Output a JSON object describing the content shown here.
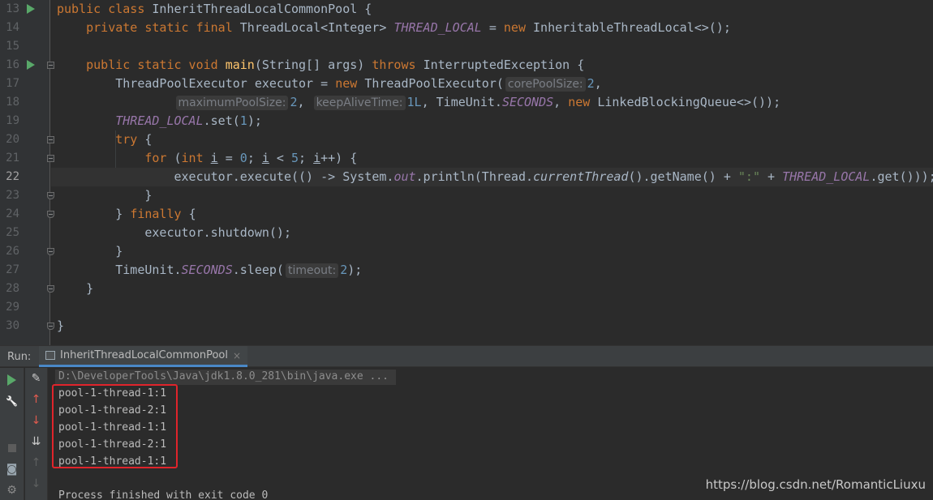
{
  "editor": {
    "line_numbers": [
      "13",
      "14",
      "15",
      "16",
      "17",
      "18",
      "19",
      "20",
      "21",
      "22",
      "23",
      "24",
      "25",
      "26",
      "27",
      "28",
      "29",
      "30"
    ],
    "current_line": "22",
    "code": {
      "l13_kw": "public class ",
      "l13_name": "InheritThreadLocalCommonPool {",
      "l14_kw": "private static final ",
      "l14_type": "ThreadLocal<Integer> ",
      "l14_field": "THREAD_LOCAL",
      "l14_eq": " = ",
      "l14_new": "new ",
      "l14_rest": "InheritableThreadLocal<>();",
      "l16_kw": "public static void ",
      "l16_fn": "main",
      "l16_params": "(String[] args) ",
      "l16_throws": "throws ",
      "l16_exc": "InterruptedException {",
      "l17_a": "ThreadPoolExecutor executor = ",
      "l17_new": "new ",
      "l17_b": "ThreadPoolExecutor(",
      "l17_hint": "corePoolSize:",
      "l17_num": "2",
      "l17_c": ",",
      "l18_hint1": "maximumPoolSize:",
      "l18_num1": "2",
      "l18_comma": ", ",
      "l18_hint2": "keepAliveTime:",
      "l18_num2": "1L",
      "l18_a": ", TimeUnit.",
      "l18_seconds": "SECONDS",
      "l18_b": ", ",
      "l18_new": "new ",
      "l18_c": "LinkedBlockingQueue<>());",
      "l19_field": "THREAD_LOCAL",
      "l19_a": ".set(",
      "l19_num": "1",
      "l19_b": ");",
      "l20_try": "try ",
      "l20_b": "{",
      "l21_for": "for ",
      "l21_a": "(",
      "l21_int": "int ",
      "l21_i1": "i",
      "l21_b": " = ",
      "l21_num0": "0",
      "l21_c": "; ",
      "l21_i2": "i",
      "l21_d": " < ",
      "l21_num5": "5",
      "l21_e": "; ",
      "l21_i3": "i",
      "l21_f": "++) {",
      "l22_a": "executor.execute(() -> System.",
      "l22_out": "out",
      "l22_b": ".println(Thread.",
      "l22_ct": "currentThread",
      "l22_c": "().getName() + ",
      "l22_str": "\":\"",
      "l22_d": " + ",
      "l22_field": "THREAD_LOCAL",
      "l22_e": ".get()));",
      "l23": "}",
      "l24_a": "} ",
      "l24_finally": "finally ",
      "l24_b": "{",
      "l25": "executor.shutdown();",
      "l26": "}",
      "l27_a": "TimeUnit.",
      "l27_seconds": "SECONDS",
      "l27_b": ".sleep(",
      "l27_hint": "timeout:",
      "l27_num": "2",
      "l27_c": ");",
      "l28": "}",
      "l30": "}"
    }
  },
  "run_window": {
    "label": "Run:",
    "tab_label": "InheritThreadLocalCommonPool",
    "tab_close": "×",
    "command": "D:\\DeveloperTools\\Java\\jdk1.8.0_281\\bin\\java.exe ...",
    "output_lines": [
      "pool-1-thread-1:1",
      "pool-1-thread-2:1",
      "pool-1-thread-1:1",
      "pool-1-thread-2:1",
      "pool-1-thread-1:1"
    ],
    "exit_message": "Process finished with exit code 0",
    "toolbar_glyphs": {
      "wrench": "🔧",
      "up_arrow": "↑",
      "down_arrow": "↓",
      "sort": "⇊",
      "edit": "✎",
      "camera": "◙",
      "bug": "⚙",
      "exit": "⇥",
      "up_gray": "↑",
      "down_gray": "↓"
    }
  },
  "watermark": "https://blog.csdn.net/RomanticLiuxu",
  "colors": {
    "editor_bg": "#2b2b2b",
    "keyword": "#cc7832",
    "method": "#ffc66d",
    "number": "#6897bb",
    "field": "#9876aa",
    "string": "#6a8759",
    "highlight_box": "#e0242b"
  }
}
